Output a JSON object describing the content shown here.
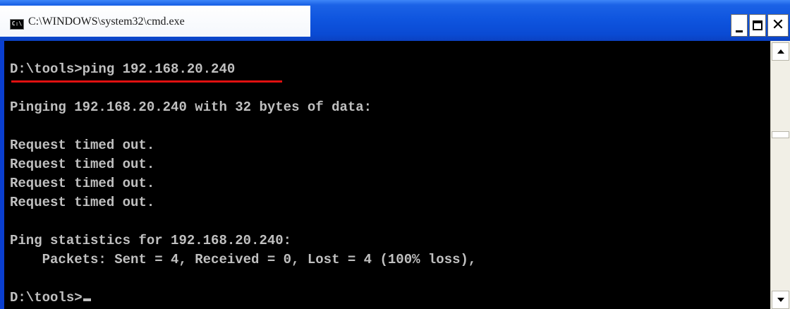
{
  "window": {
    "title": "C:\\WINDOWS\\system32\\cmd.exe",
    "icon_label": "C:\\",
    "controls": {
      "minimize": "minimize-icon",
      "maximize": "maximize-icon",
      "close": "close-icon"
    }
  },
  "terminal": {
    "lines": [
      "D:\\tools>ping 192.168.20.240",
      "",
      "Pinging 192.168.20.240 with 32 bytes of data:",
      "",
      "Request timed out.",
      "Request timed out.",
      "Request timed out.",
      "Request timed out.",
      "",
      "Ping statistics for 192.168.20.240:",
      "    Packets: Sent = 4, Received = 0, Lost = 4 (100% loss),",
      "",
      "D:\\tools>"
    ]
  },
  "colors": {
    "terminal_text": "#c0c0c0",
    "terminal_bg": "#000000",
    "titlebar": "#0a4ad3",
    "annotation": "#e01010"
  }
}
